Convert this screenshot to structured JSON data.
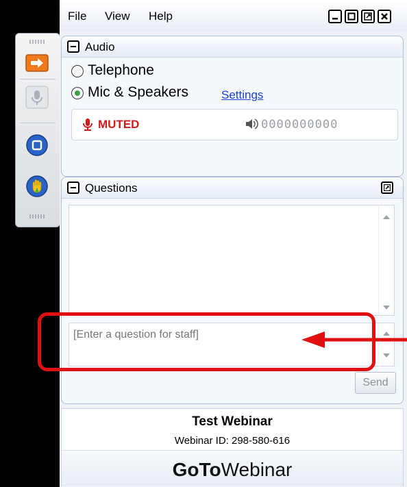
{
  "menu": {
    "file": "File",
    "view": "View",
    "help": "Help"
  },
  "audio": {
    "title": "Audio",
    "option_telephone": "Telephone",
    "option_mic": "Mic & Speakers",
    "settings_link": "Settings",
    "status": "MUTED",
    "level_readout": "0000000000"
  },
  "questions": {
    "title": "Questions",
    "input_placeholder": "[Enter a question for staff]",
    "send_label": "Send"
  },
  "webinar": {
    "title": "Test Webinar",
    "id_text": "Webinar ID: 298-580-616"
  },
  "brand": {
    "bold": "GoTo",
    "regular": "Webinar"
  },
  "colors": {
    "accent_orange": "#f07a1a",
    "muted_red": "#d21a1a",
    "link_blue": "#1a3fd6",
    "highlight_red": "#e01010"
  },
  "icons": [
    "screen-share-icon",
    "mic-icon",
    "stop-icon",
    "raise-hand-icon",
    "minimize-icon",
    "restore-icon",
    "popout-icon",
    "close-icon"
  ]
}
